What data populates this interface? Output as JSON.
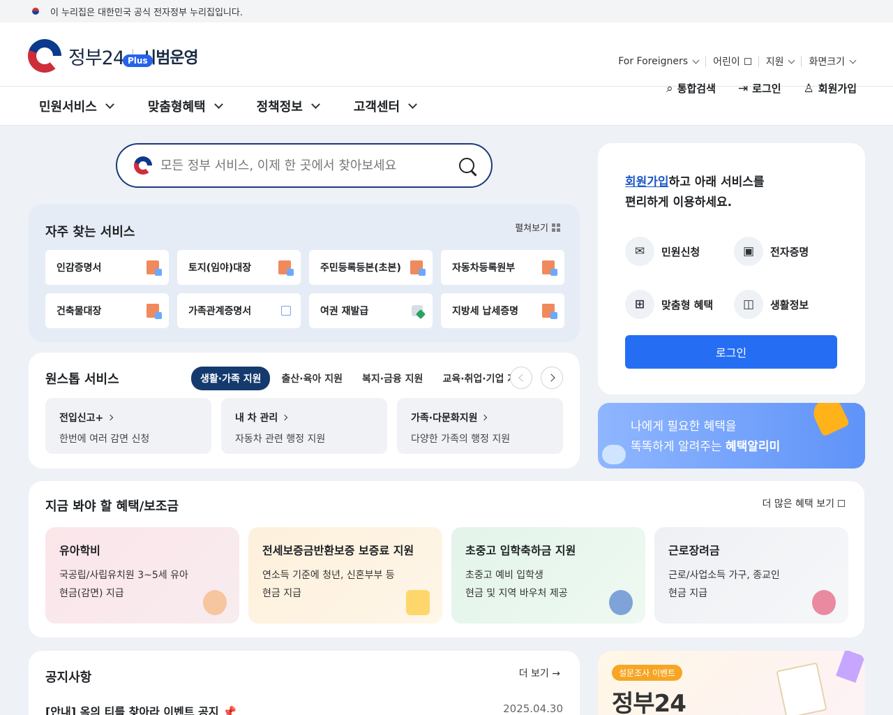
{
  "gov_banner": {
    "text": "이 누리집은 대한민국 공식 전자정부 누리집입니다."
  },
  "header": {
    "logo_name": "정부24",
    "logo_sub": "시범운영",
    "plus_badge": "Plus",
    "util": [
      "For Foreigners",
      "어린이",
      "지원",
      "화면크기"
    ],
    "actions": {
      "search": "통합검색",
      "login": "로그인",
      "signup": "회원가입"
    }
  },
  "nav": [
    "민원서비스",
    "맞춤형혜택",
    "정책정보",
    "고객센터"
  ],
  "search": {
    "placeholder": "모든 정부 서비스, 이제 한 곳에서 찾아보세요"
  },
  "frequent": {
    "title": "자주 찾는 서비스",
    "expand": "펼쳐보기",
    "items": [
      "인감증명서",
      "토지(임야)대장",
      "주민등록등본(초본)",
      "자동차등록원부",
      "건축물대장",
      "가족관계증명서",
      "여권 재발급",
      "지방세 납세증명"
    ]
  },
  "onestop": {
    "title": "원스톱 서비스",
    "tabs": [
      "생활·가족 지원",
      "출산·육아 지원",
      "복지·금융 지원",
      "교육·취업·기업 지원"
    ],
    "cards": [
      {
        "title": "전입신고+",
        "desc": "한번에 여러 감면 신청"
      },
      {
        "title": "내 차 관리",
        "desc": "자동차 관련 행정 지원"
      },
      {
        "title": "가족·다문화지원",
        "desc": "다양한 가족의 행정 지원"
      }
    ]
  },
  "login_card": {
    "link": "회원가입",
    "msg1": "하고 아래 서비스를",
    "msg2": "편리하게 이용하세요.",
    "quick": [
      "민원신청",
      "전자증명",
      "맞춤형 혜택",
      "생활정보"
    ],
    "button": "로그인"
  },
  "alert": {
    "line1": "나에게 필요한 혜택을",
    "line2_pre": "똑똑하게 알려주는 ",
    "line2_bold": "혜택알리미"
  },
  "benefits": {
    "title": "지금 봐야 할 혜택/보조금",
    "more": "더 많은 혜택 보기",
    "cards": [
      {
        "title": "유아학비",
        "d1": "국공립/사립유치원 3~5세 유아",
        "d2": "현금(감면) 지급"
      },
      {
        "title": "전세보증금반환보증 보증료 지원",
        "d1": "연소득 기준에 청년, 신혼부부 등",
        "d2": "현금 지급"
      },
      {
        "title": "초중고 입학축하금 지원",
        "d1": "초중고 예비 입학생",
        "d2": "현금 및 지역 바우처 제공"
      },
      {
        "title": "근로장려금",
        "d1": "근로/사업소득 가구, 종교인",
        "d2": "현금 지급"
      }
    ]
  },
  "notice": {
    "title": "공지사항",
    "more": "더 보기 →",
    "row": {
      "title": "[안내] 옥의 티를 찾아라 이벤트 공지 📌",
      "date": "2025.04.30"
    }
  },
  "survey": {
    "pill": "설문조사 이벤트",
    "big": "정부24"
  },
  "colors": {
    "accent": "#256ef4",
    "navy": "#143a6e"
  }
}
